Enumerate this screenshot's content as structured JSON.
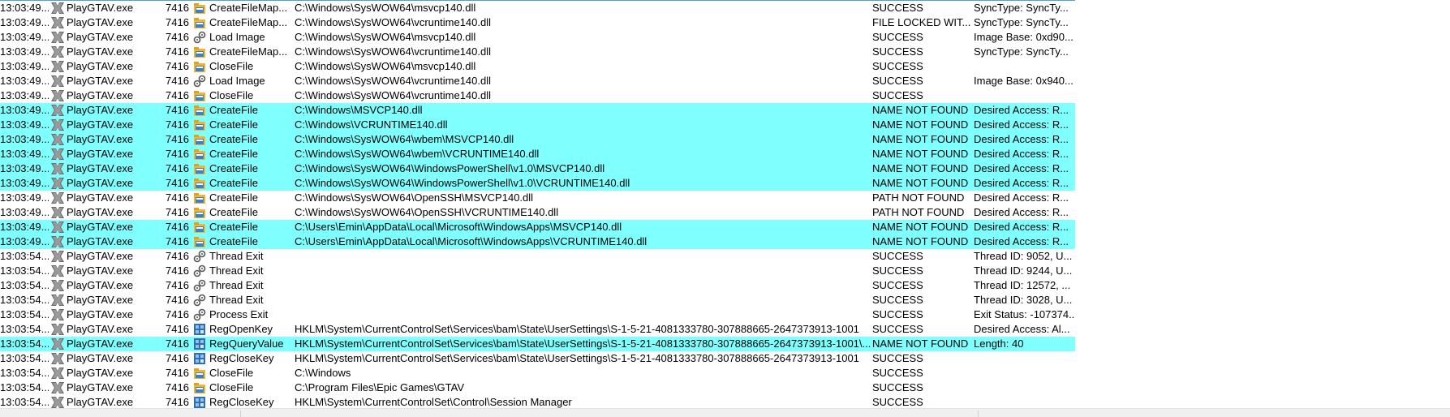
{
  "colors": {
    "highlight": "#80ffff",
    "process_icon": "#5a5a5a"
  },
  "rows": [
    {
      "time": "13:03:49...",
      "process": "PlayGTAV.exe",
      "pid": "7416",
      "icon": "file-icon",
      "operation": "CreateFileMap...",
      "path": "C:\\Windows\\SysWOW64\\msvcp140.dll",
      "result": "SUCCESS",
      "detail": "SyncType: SyncTy...",
      "highlight": false
    },
    {
      "time": "13:03:49...",
      "process": "PlayGTAV.exe",
      "pid": "7416",
      "icon": "file-icon",
      "operation": "CreateFileMap...",
      "path": "C:\\Windows\\SysWOW64\\vcruntime140.dll",
      "result": "FILE LOCKED WIT...",
      "detail": "SyncType: SyncTy...",
      "highlight": false
    },
    {
      "time": "13:03:49...",
      "process": "PlayGTAV.exe",
      "pid": "7416",
      "icon": "process-gears-icon",
      "operation": "Load Image",
      "path": "C:\\Windows\\SysWOW64\\msvcp140.dll",
      "result": "SUCCESS",
      "detail": "Image Base: 0xd90...",
      "highlight": false
    },
    {
      "time": "13:03:49...",
      "process": "PlayGTAV.exe",
      "pid": "7416",
      "icon": "file-icon",
      "operation": "CreateFileMap...",
      "path": "C:\\Windows\\SysWOW64\\vcruntime140.dll",
      "result": "SUCCESS",
      "detail": "SyncType: SyncTy...",
      "highlight": false
    },
    {
      "time": "13:03:49...",
      "process": "PlayGTAV.exe",
      "pid": "7416",
      "icon": "file-icon",
      "operation": "CloseFile",
      "path": "C:\\Windows\\SysWOW64\\msvcp140.dll",
      "result": "SUCCESS",
      "detail": "",
      "highlight": false
    },
    {
      "time": "13:03:49...",
      "process": "PlayGTAV.exe",
      "pid": "7416",
      "icon": "process-gears-icon",
      "operation": "Load Image",
      "path": "C:\\Windows\\SysWOW64\\vcruntime140.dll",
      "result": "SUCCESS",
      "detail": "Image Base: 0x940...",
      "highlight": false
    },
    {
      "time": "13:03:49...",
      "process": "PlayGTAV.exe",
      "pid": "7416",
      "icon": "file-icon",
      "operation": "CloseFile",
      "path": "C:\\Windows\\SysWOW64\\vcruntime140.dll",
      "result": "SUCCESS",
      "detail": "",
      "highlight": false
    },
    {
      "time": "13:03:49...",
      "process": "PlayGTAV.exe",
      "pid": "7416",
      "icon": "file-icon",
      "operation": "CreateFile",
      "path": "C:\\Windows\\MSVCP140.dll",
      "result": "NAME NOT FOUND",
      "detail": "Desired Access: R...",
      "highlight": true
    },
    {
      "time": "13:03:49...",
      "process": "PlayGTAV.exe",
      "pid": "7416",
      "icon": "file-icon",
      "operation": "CreateFile",
      "path": "C:\\Windows\\VCRUNTIME140.dll",
      "result": "NAME NOT FOUND",
      "detail": "Desired Access: R...",
      "highlight": true
    },
    {
      "time": "13:03:49...",
      "process": "PlayGTAV.exe",
      "pid": "7416",
      "icon": "file-icon",
      "operation": "CreateFile",
      "path": "C:\\Windows\\SysWOW64\\wbem\\MSVCP140.dll",
      "result": "NAME NOT FOUND",
      "detail": "Desired Access: R...",
      "highlight": true
    },
    {
      "time": "13:03:49...",
      "process": "PlayGTAV.exe",
      "pid": "7416",
      "icon": "file-icon",
      "operation": "CreateFile",
      "path": "C:\\Windows\\SysWOW64\\wbem\\VCRUNTIME140.dll",
      "result": "NAME NOT FOUND",
      "detail": "Desired Access: R...",
      "highlight": true
    },
    {
      "time": "13:03:49...",
      "process": "PlayGTAV.exe",
      "pid": "7416",
      "icon": "file-icon",
      "operation": "CreateFile",
      "path": "C:\\Windows\\SysWOW64\\WindowsPowerShell\\v1.0\\MSVCP140.dll",
      "result": "NAME NOT FOUND",
      "detail": "Desired Access: R...",
      "highlight": true
    },
    {
      "time": "13:03:49...",
      "process": "PlayGTAV.exe",
      "pid": "7416",
      "icon": "file-icon",
      "operation": "CreateFile",
      "path": "C:\\Windows\\SysWOW64\\WindowsPowerShell\\v1.0\\VCRUNTIME140.dll",
      "result": "NAME NOT FOUND",
      "detail": "Desired Access: R...",
      "highlight": true
    },
    {
      "time": "13:03:49...",
      "process": "PlayGTAV.exe",
      "pid": "7416",
      "icon": "file-icon",
      "operation": "CreateFile",
      "path": "C:\\Windows\\SysWOW64\\OpenSSH\\MSVCP140.dll",
      "result": "PATH NOT FOUND",
      "detail": "Desired Access: R...",
      "highlight": false
    },
    {
      "time": "13:03:49...",
      "process": "PlayGTAV.exe",
      "pid": "7416",
      "icon": "file-icon",
      "operation": "CreateFile",
      "path": "C:\\Windows\\SysWOW64\\OpenSSH\\VCRUNTIME140.dll",
      "result": "PATH NOT FOUND",
      "detail": "Desired Access: R...",
      "highlight": false
    },
    {
      "time": "13:03:49...",
      "process": "PlayGTAV.exe",
      "pid": "7416",
      "icon": "file-icon",
      "operation": "CreateFile",
      "path": "C:\\Users\\Emin\\AppData\\Local\\Microsoft\\WindowsApps\\MSVCP140.dll",
      "result": "NAME NOT FOUND",
      "detail": "Desired Access: R...",
      "highlight": true
    },
    {
      "time": "13:03:49...",
      "process": "PlayGTAV.exe",
      "pid": "7416",
      "icon": "file-icon",
      "operation": "CreateFile",
      "path": "C:\\Users\\Emin\\AppData\\Local\\Microsoft\\WindowsApps\\VCRUNTIME140.dll",
      "result": "NAME NOT FOUND",
      "detail": "Desired Access: R...",
      "highlight": true
    },
    {
      "time": "13:03:54...",
      "process": "PlayGTAV.exe",
      "pid": "7416",
      "icon": "process-gears-icon",
      "operation": "Thread Exit",
      "path": "",
      "result": "SUCCESS",
      "detail": "Thread ID: 9052, U...",
      "highlight": false
    },
    {
      "time": "13:03:54...",
      "process": "PlayGTAV.exe",
      "pid": "7416",
      "icon": "process-gears-icon",
      "operation": "Thread Exit",
      "path": "",
      "result": "SUCCESS",
      "detail": "Thread ID: 9244, U...",
      "highlight": false
    },
    {
      "time": "13:03:54...",
      "process": "PlayGTAV.exe",
      "pid": "7416",
      "icon": "process-gears-icon",
      "operation": "Thread Exit",
      "path": "",
      "result": "SUCCESS",
      "detail": "Thread ID: 12572, ...",
      "highlight": false
    },
    {
      "time": "13:03:54...",
      "process": "PlayGTAV.exe",
      "pid": "7416",
      "icon": "process-gears-icon",
      "operation": "Thread Exit",
      "path": "",
      "result": "SUCCESS",
      "detail": "Thread ID: 3028, U...",
      "highlight": false
    },
    {
      "time": "13:03:54...",
      "process": "PlayGTAV.exe",
      "pid": "7416",
      "icon": "process-gears-icon",
      "operation": "Process Exit",
      "path": "",
      "result": "SUCCESS",
      "detail": "Exit Status: -107374...",
      "highlight": false
    },
    {
      "time": "13:03:54...",
      "process": "PlayGTAV.exe",
      "pid": "7416",
      "icon": "registry-icon",
      "operation": "RegOpenKey",
      "path": "HKLM\\System\\CurrentControlSet\\Services\\bam\\State\\UserSettings\\S-1-5-21-4081333780-307888665-2647373913-1001",
      "result": "SUCCESS",
      "detail": "Desired Access: Al...",
      "highlight": false
    },
    {
      "time": "13:03:54...",
      "process": "PlayGTAV.exe",
      "pid": "7416",
      "icon": "registry-icon",
      "operation": "RegQueryValue",
      "path": "HKLM\\System\\CurrentControlSet\\Services\\bam\\State\\UserSettings\\S-1-5-21-4081333780-307888665-2647373913-1001\\...",
      "result": "NAME NOT FOUND",
      "detail": "Length: 40",
      "highlight": true
    },
    {
      "time": "13:03:54...",
      "process": "PlayGTAV.exe",
      "pid": "7416",
      "icon": "registry-icon",
      "operation": "RegCloseKey",
      "path": "HKLM\\System\\CurrentControlSet\\Services\\bam\\State\\UserSettings\\S-1-5-21-4081333780-307888665-2647373913-1001",
      "result": "SUCCESS",
      "detail": "",
      "highlight": false
    },
    {
      "time": "13:03:54...",
      "process": "PlayGTAV.exe",
      "pid": "7416",
      "icon": "file-icon",
      "operation": "CloseFile",
      "path": "C:\\Windows",
      "result": "SUCCESS",
      "detail": "",
      "highlight": false
    },
    {
      "time": "13:03:54...",
      "process": "PlayGTAV.exe",
      "pid": "7416",
      "icon": "file-icon",
      "operation": "CloseFile",
      "path": "C:\\Program Files\\Epic Games\\GTAV",
      "result": "SUCCESS",
      "detail": "",
      "highlight": false
    },
    {
      "time": "13:03:54...",
      "process": "PlayGTAV.exe",
      "pid": "7416",
      "icon": "registry-icon",
      "operation": "RegCloseKey",
      "path": "HKLM\\System\\CurrentControlSet\\Control\\Session Manager",
      "result": "SUCCESS",
      "detail": "",
      "highlight": false
    }
  ]
}
